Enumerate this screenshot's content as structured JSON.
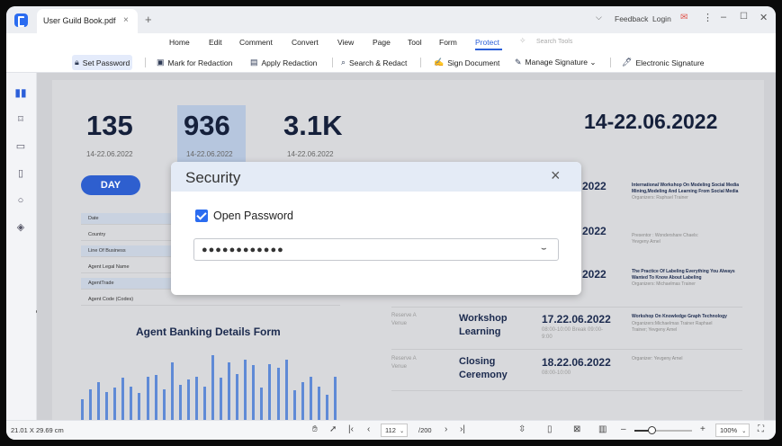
{
  "titlebar": {
    "tab_label": "User Guild Book.pdf",
    "tab_close": "×",
    "tab_add": "+",
    "feedback": "Feedback",
    "login": "Login"
  },
  "menu": {
    "items": [
      "Home",
      "Edit",
      "Comment",
      "Convert",
      "View",
      "Page",
      "Tool",
      "Form",
      "Protect"
    ],
    "active": "Protect",
    "search_placeholder": "Search Tools"
  },
  "toolbar": {
    "items": [
      "Set Password",
      "Mark for Redaction",
      "Apply Redaction",
      "Search & Redact",
      "Sign Document",
      "Manage Signature ⌄",
      "Electronic Signature"
    ],
    "active": "Set Password"
  },
  "document": {
    "stats": [
      {
        "value": "135",
        "date": "14-22.06.2022"
      },
      {
        "value": "936",
        "date": "14-22.06.2022"
      },
      {
        "value": "3.1K",
        "date": "14-22.06.2022"
      }
    ],
    "big_date": "14-22.06.2022",
    "day_label": "DAY",
    "form_rows": [
      "Date",
      "Country",
      "Line Of Business",
      "Agent Legal Name",
      "AgentTrade",
      "Agent Code (Codes)"
    ],
    "form_title": "Agent Banking Details Form",
    "bar_values": [
      0.29,
      0.44,
      0.54,
      0.4,
      0.46,
      0.6,
      0.48,
      0.38,
      0.62,
      0.64,
      0.44,
      0.82,
      0.5,
      0.58,
      0.62,
      0.48,
      0.92,
      0.6,
      0.82,
      0.66,
      0.86,
      0.78,
      0.46,
      0.8,
      0.74,
      0.86,
      0.42,
      0.54,
      0.62,
      0.48,
      0.36,
      0.62
    ],
    "schedule_fragments": [
      "2022",
      "2022",
      "2022"
    ],
    "schedule_descs": [
      {
        "title": "International Workshop On Modeling Social Media Mining,Modeling And Learning From Social Media",
        "sub": "Organizers: Raphael Trainer"
      },
      {
        "title": "",
        "sub": "Presentor : Wondershare Chaels: Yevgeny Arnel"
      },
      {
        "title": "The Practice Of Labeling Everything You Always Wanted To Know About Labeling",
        "sub": "Organizers: Michaelmas Trainer"
      }
    ],
    "schedule": [
      {
        "place": "Reserve A Venue",
        "title": "Workshop Learning",
        "date": "17.22.06.2022",
        "time": "08:00-10:00 Break 09:00-9:00",
        "desc_title": "Workshop On Knowledge Graph Technology",
        "desc_sub": "Organizers:Michaelmas Trainer Raphael Trainer; Yevgeny Arnel"
      },
      {
        "place": "Reserve A Venue",
        "title": "Closing Ceremony",
        "date": "18.22.06.2022",
        "time": "08:00-10:00",
        "desc_title": "",
        "desc_sub": "Organizer: Yevgeny Arnel"
      }
    ]
  },
  "dialog": {
    "title": "Security",
    "close": "×",
    "checkbox_label": "Open Password",
    "checkbox_checked": true,
    "password_mask": "●●●●●●●●●●●●"
  },
  "status": {
    "dimensions": "21.01 X 29.69 cm",
    "page_current": "112",
    "page_total": "/200",
    "zoom": "100%",
    "zoom_level": 0.25
  },
  "colors": {
    "accent": "#2b6cf0",
    "dark_text": "#15203b",
    "bar": "#5f8ad6"
  }
}
